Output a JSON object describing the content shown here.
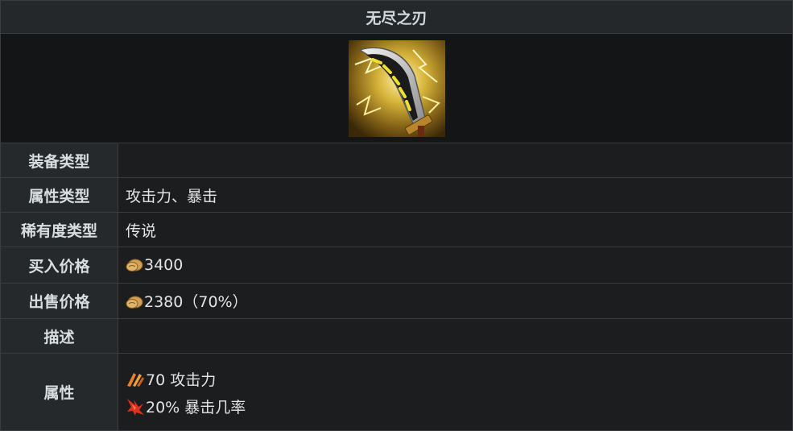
{
  "title": "无尽之刃",
  "image": {
    "icon": "infinity-edge-sword-icon"
  },
  "rows": {
    "equipment_type": {
      "label": "装备类型",
      "value": ""
    },
    "attribute_type": {
      "label": "属性类型",
      "value": "攻击力、暴击"
    },
    "rarity_type": {
      "label": "稀有度类型",
      "value": "传说"
    },
    "buy_price": {
      "label": "买入价格",
      "icon": "gold-coin-icon",
      "value": "3400"
    },
    "sell_price": {
      "label": "出售价格",
      "icon": "gold-coin-icon",
      "value": "2380（70%）"
    },
    "description": {
      "label": "描述",
      "value": ""
    },
    "properties": {
      "label": "属性",
      "stats": [
        {
          "icon": "attack-damage-icon",
          "text": "70 攻击力"
        },
        {
          "icon": "critical-strike-icon",
          "text": "20% 暴击几率"
        }
      ]
    }
  },
  "colors": {
    "background": "#1b1c1e",
    "label_background": "#26292b",
    "border": "#3a3c3f",
    "gold": "#d4a056",
    "attack_orange": "#e8812d",
    "crit_red": "#e0301e"
  }
}
